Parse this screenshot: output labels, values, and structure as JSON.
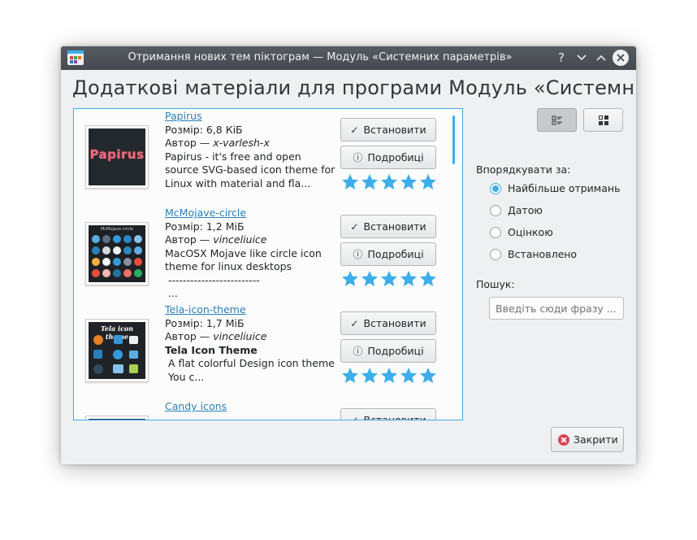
{
  "window": {
    "title": "Отримання нових тем піктограм — Модуль «Системних параметрів»",
    "help_glyph": "?",
    "minimize_glyph": "⌄",
    "maximize_glyph": "⌃"
  },
  "heading": "Додаткові матеріали для програми Модуль «Системних",
  "items": [
    {
      "name": "Papirus",
      "size": "Розмір: 6,8 КіБ",
      "author_prefix": "Автор — ",
      "author": "x-varlesh-x",
      "description": "Papirus - it's free and open source SVG-based icon theme for Linux with material and fla...",
      "thumb_text": "Papirus",
      "install_label": "Встановити",
      "details_label": "Подробиці",
      "rating_stars": 5
    },
    {
      "name": "McMojave-circle",
      "size": "Розмір: 1,2 МіБ",
      "author_prefix": "Автор — ",
      "author": "vinceliuice",
      "description": "MacOSX Mojave like circle icon theme for linux desktops\n -------------------------\n ...",
      "thumb_text": "McMojave circle",
      "install_label": "Встановити",
      "details_label": "Подробиці",
      "rating_stars": 5
    },
    {
      "name": "Tela-icon-theme",
      "size": "Розмір: 1,7 МіБ",
      "author_prefix": "Автор — ",
      "author": "vinceliuice",
      "description_bold": "Tela Icon Theme",
      "description": " A flat colorful Design icon theme\n You c...",
      "thumb_text": "Tela icon theme",
      "install_label": "Встановити",
      "details_label": "Подробиці",
      "rating_stars": 5
    },
    {
      "name": "Candy icons",
      "install_label": "Встановити"
    }
  ],
  "sort": {
    "label": "Впорядкувати за:",
    "options": [
      "Найбільше отримань",
      "Датою",
      "Оцінкою",
      "Встановлено"
    ],
    "selected": "Найбільше отримань"
  },
  "search": {
    "label": "Пошук:",
    "placeholder": "Введіть сюди фразу ..."
  },
  "close_label": "Закрити",
  "colors": {
    "accent": "#3daee9",
    "star": "#3daee9",
    "link": "#2980b9",
    "close_icon": "#da4453"
  }
}
